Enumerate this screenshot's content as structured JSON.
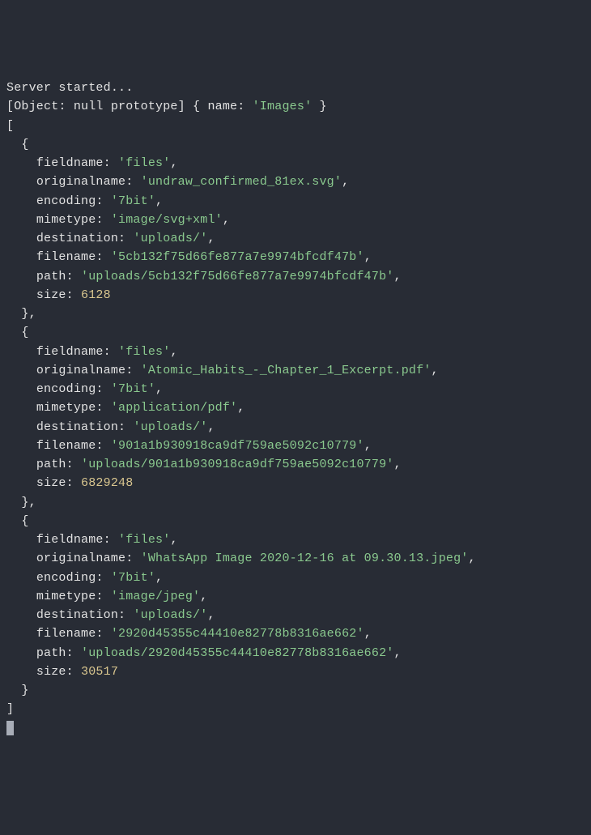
{
  "header": {
    "server_started": "Server started...",
    "object_prefix": "[Object: null prototype] { name: ",
    "name_value": "'Images'",
    "object_suffix": " }"
  },
  "brackets": {
    "open_array": "[",
    "close_array": "]",
    "open_obj": "{",
    "close_obj": "}",
    "close_obj_comma": "},",
    "comma": ","
  },
  "labels": {
    "fieldname": "fieldname: ",
    "originalname": "originalname: ",
    "encoding": "encoding: ",
    "mimetype": "mimetype: ",
    "destination": "destination: ",
    "filename": "filename: ",
    "path": "path: ",
    "size": "size: "
  },
  "files": [
    {
      "fieldname": "'files'",
      "originalname": "'undraw_confirmed_81ex.svg'",
      "encoding": "'7bit'",
      "mimetype": "'image/svg+xml'",
      "destination": "'uploads/'",
      "filename": "'5cb132f75d66fe877a7e9974bfcdf47b'",
      "path": "'uploads/5cb132f75d66fe877a7e9974bfcdf47b'",
      "size": "6128"
    },
    {
      "fieldname": "'files'",
      "originalname": "'Atomic_Habits_-_Chapter_1_Excerpt.pdf'",
      "encoding": "'7bit'",
      "mimetype": "'application/pdf'",
      "destination": "'uploads/'",
      "filename": "'901a1b930918ca9df759ae5092c10779'",
      "path": "'uploads/901a1b930918ca9df759ae5092c10779'",
      "size": "6829248"
    },
    {
      "fieldname": "'files'",
      "originalname": "'WhatsApp Image 2020-12-16 at 09.30.13.jpeg'",
      "encoding": "'7bit'",
      "mimetype": "'image/jpeg'",
      "destination": "'uploads/'",
      "filename": "'2920d45355c44410e82778b8316ae662'",
      "path": "'uploads/2920d45355c44410e82778b8316ae662'",
      "size": "30517"
    }
  ]
}
